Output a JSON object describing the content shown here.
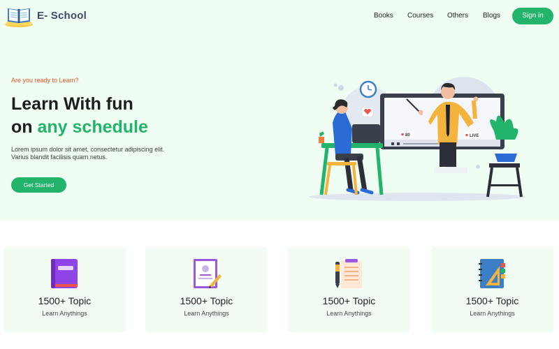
{
  "header": {
    "brand": "E- School",
    "nav": [
      "Books",
      "Courses",
      "Others",
      "Blogs"
    ],
    "signin_label": "Sign in",
    "logo_icon": "open-book-logo-icon"
  },
  "hero": {
    "eyebrow": "Are you ready to Learn?",
    "headline_line1": "Learn With fun",
    "headline_on": "on",
    "headline_accent": "any schedule",
    "description": "Lorem ipsum dolor sit amet, consectetur adipiscing elit. Varius blandit facilisis quam netus.",
    "cta_label": "Get Started",
    "video": {
      "viewers": "80",
      "live_badge": "LIVE"
    }
  },
  "cards": [
    {
      "title": "1500+ Topic",
      "subtitle": "Learn Anythings",
      "icon": "purple-book-icon"
    },
    {
      "title": "1500+ Topic",
      "subtitle": "Learn Anythings",
      "icon": "certificate-icon"
    },
    {
      "title": "1500+ Topic",
      "subtitle": "Learn Anythings",
      "icon": "notepad-pen-icon"
    },
    {
      "title": "1500+ Topic",
      "subtitle": "Learn Anythings",
      "icon": "notebook-ruler-icon"
    }
  ],
  "colors": {
    "accent": "#22b46a",
    "eyebrow": "#e5521e",
    "brand": "#41476b",
    "hero_bg": "#effdf3"
  }
}
